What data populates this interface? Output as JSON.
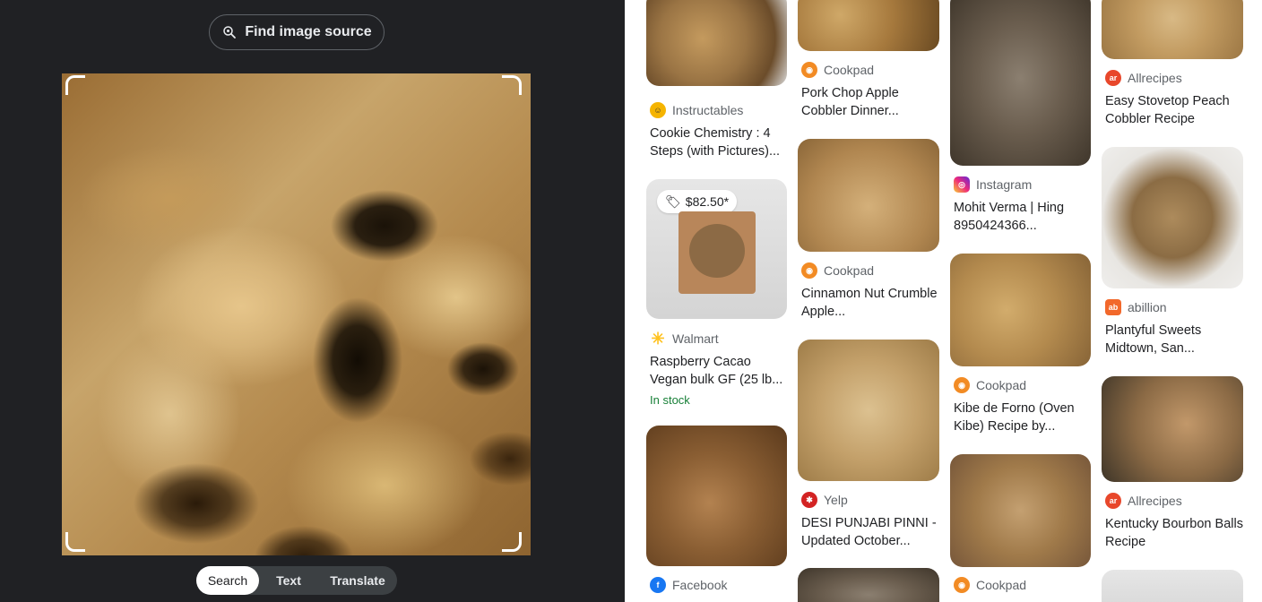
{
  "lens": {
    "find_source_label": "Find image source",
    "modes": [
      "Search",
      "Text",
      "Translate"
    ],
    "active_mode": "Search"
  },
  "results": {
    "col1": [
      {
        "source": "Instructables",
        "title": "Cookie Chemistry : 4 Steps (with Pictures)..."
      },
      {
        "price": "$82.50*",
        "source": "Walmart",
        "title": "Raspberry Cacao Vegan bulk GF (25 lb...",
        "stock": "In stock"
      },
      {
        "source": "Facebook",
        "title": ""
      }
    ],
    "col2": [
      {
        "source": "Cookpad",
        "title": "Pork Chop Apple Cobbler Dinner..."
      },
      {
        "source": "Cookpad",
        "title": "Cinnamon Nut Crumble Apple..."
      },
      {
        "source": "Yelp",
        "title": "DESI PUNJABI PINNI - Updated October..."
      }
    ],
    "col3": [
      {
        "source": "Instagram",
        "title": "Mohit Verma | Hing 8950424366..."
      },
      {
        "source": "Cookpad",
        "title": "Kibe de Forno (Oven Kibe) Recipe by..."
      },
      {
        "source": "Cookpad",
        "title": ""
      }
    ],
    "col4": [
      {
        "source": "Allrecipes",
        "title": "Easy Stovetop Peach Cobbler Recipe"
      },
      {
        "source": "abillion",
        "title": "Plantyful Sweets Midtown, San..."
      },
      {
        "source": "Allrecipes",
        "title": "Kentucky Bourbon Balls Recipe"
      }
    ]
  },
  "colors": {
    "dark_bg": "#202124",
    "in_stock": "#188038",
    "cookpad": "#f28b24",
    "allrecipes": "#e8472b",
    "abillion": "#f2682b",
    "yelp": "#d32323",
    "walmart": "#ffc220",
    "facebook": "#1877f2"
  }
}
